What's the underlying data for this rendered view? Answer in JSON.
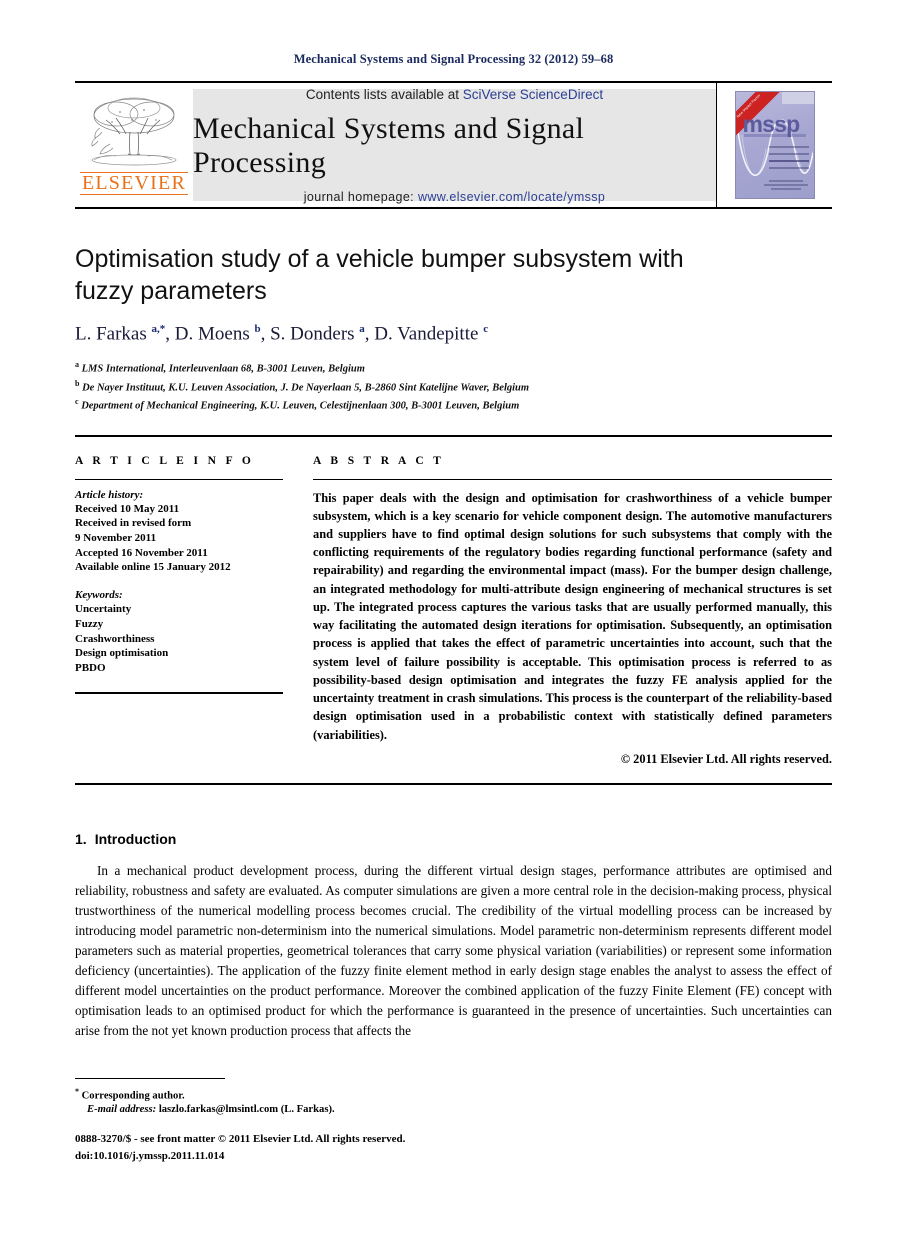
{
  "running_head": "Mechanical Systems and Signal Processing 32 (2012) 59–68",
  "masthead": {
    "publisher_name": "ELSEVIER",
    "contents_prefix": "Contents lists available at ",
    "contents_link": "SciVerse ScienceDirect",
    "journal_name": "Mechanical Systems and Signal Processing",
    "homepage_prefix": "journal homepage: ",
    "homepage_url": "www.elsevier.com/locate/ymssp",
    "cover_title": "mssp",
    "cover_ribbon": "New Impact Factor"
  },
  "article": {
    "title": "Optimisation study of a vehicle bumper subsystem with fuzzy parameters",
    "authors_html": "L. Farkas <sup>a,*</sup>, D. Moens <sup>b</sup>, S. Donders <sup>a</sup>, D. Vandepitte <sup>c</sup>",
    "affiliations": [
      {
        "marker": "a",
        "text": "LMS International, Interleuvenlaan 68, B-3001 Leuven, Belgium"
      },
      {
        "marker": "b",
        "text": "De Nayer Instituut, K.U. Leuven Association, J. De Nayerlaan 5, B-2860 Sint Katelijne Waver, Belgium"
      },
      {
        "marker": "c",
        "text": "Department of Mechanical Engineering, K.U. Leuven, Celestijnenlaan 300, B-3001 Leuven, Belgium"
      }
    ]
  },
  "article_info": {
    "heading": "A R T I C L E  I N F O",
    "history_label": "Article history:",
    "history": [
      "Received 10 May 2011",
      "Received in revised form",
      "9 November 2011",
      "Accepted 16 November 2011",
      "Available online 15 January 2012"
    ],
    "keywords_label": "Keywords:",
    "keywords": [
      "Uncertainty",
      "Fuzzy",
      "Crashworthiness",
      "Design optimisation",
      "PBDO"
    ]
  },
  "abstract": {
    "heading": "A B S T R A C T",
    "text": "This paper deals with the design and optimisation for crashworthiness of a vehicle bumper subsystem, which is a key scenario for vehicle component design. The automotive manufacturers and suppliers have to find optimal design solutions for such subsystems that comply with the conflicting requirements of the regulatory bodies regarding functional performance (safety and repairability) and regarding the environmental impact (mass). For the bumper design challenge, an integrated methodology for multi-attribute design engineering of mechanical structures is set up. The integrated process captures the various tasks that are usually performed manually, this way facilitating the automated design iterations for optimisation. Subsequently, an optimisation process is applied that takes the effect of parametric uncertainties into account, such that the system level of failure possibility is acceptable. This optimisation process is referred to as possibility-based design optimisation and integrates the fuzzy FE analysis applied for the uncertainty treatment in crash simulations. This process is the counterpart of the reliability-based design optimisation used in a probabilistic context with statistically defined parameters (variabilities).",
    "copyright": "© 2011 Elsevier Ltd. All rights reserved."
  },
  "body": {
    "section_number": "1.",
    "section_title": "Introduction",
    "paragraph": "In a mechanical product development process, during the different virtual design stages, performance attributes are optimised and reliability, robustness and safety are evaluated. As computer simulations are given a more central role in the decision-making process, physical trustworthiness of the numerical modelling process becomes crucial. The credibility of the virtual modelling process can be increased by introducing model parametric non-determinism into the numerical simulations. Model parametric non-determinism represents different model parameters such as material properties, geometrical tolerances that carry some physical variation (variabilities) or represent some information deficiency (uncertainties). The application of the fuzzy finite element method in early design stage enables the analyst to assess the effect of different model uncertainties on the product performance. Moreover the combined application of the fuzzy Finite Element (FE) concept with optimisation leads to an optimised product for which the performance is guaranteed in the presence of uncertainties. Such uncertainties can arise from the not yet known production process that affects the"
  },
  "footer": {
    "corresponding": "Corresponding author.",
    "email_label": "E-mail address:",
    "email_value": "laszlo.farkas@lmsintl.com (L. Farkas).",
    "issn_line": "0888-3270/$ - see front matter © 2011 Elsevier Ltd. All rights reserved.",
    "doi_line": "doi:10.1016/j.ymssp.2011.11.014"
  },
  "colors": {
    "running_head": "#1a2a5e",
    "link_blue": "#2b3f94",
    "elsevier_orange": "#E9711C",
    "banner_gray": "#e6e6e6"
  }
}
